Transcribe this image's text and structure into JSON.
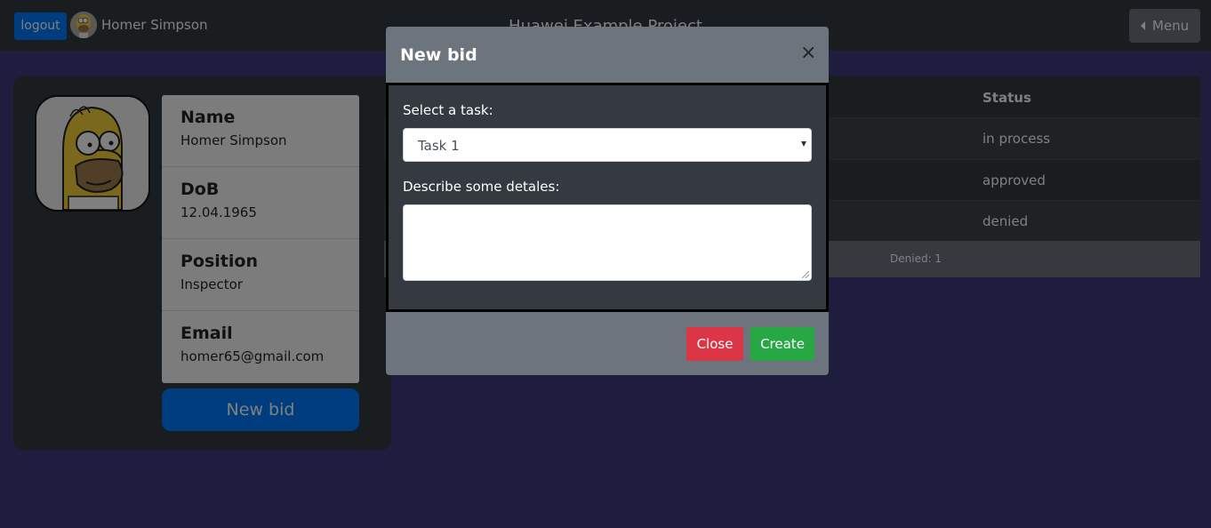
{
  "navbar": {
    "logout_label": "logout",
    "user_name": "Homer Simpson",
    "title": "Huawei Example Project",
    "menu_label": "Menu"
  },
  "profile": {
    "fields": [
      {
        "label": "Name",
        "value": "Homer Simpson"
      },
      {
        "label": "DoB",
        "value": "12.04.1965"
      },
      {
        "label": "Position",
        "value": "Inspector"
      },
      {
        "label": "Email",
        "value": "homer65@gmail.com"
      }
    ],
    "new_bid_label": "New bid"
  },
  "table": {
    "status_header": "Status",
    "rows": [
      {
        "status": "in process"
      },
      {
        "status": "approved"
      },
      {
        "status": "denied"
      }
    ],
    "footer": {
      "denied": "Denied: 1"
    }
  },
  "modal": {
    "title": "New bid",
    "close_glyph": "×",
    "task_label": "Select a task:",
    "task_selected": "Task 1",
    "details_label": "Describe some detales:",
    "details_value": "",
    "close_label": "Close",
    "create_label": "Create"
  },
  "colors": {
    "page_bg": "#3d3a7c",
    "navbar_bg": "#343a40",
    "primary": "#007bff",
    "danger": "#dc3545",
    "success": "#28a745",
    "secondary": "#6c757d"
  }
}
